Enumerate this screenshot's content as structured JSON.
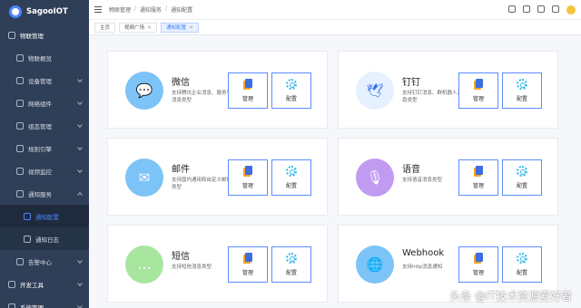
{
  "app": {
    "logo_text": "SagooIOT"
  },
  "header": {
    "breadcrumb": [
      "物联管理",
      "通知服务",
      "通知配置"
    ]
  },
  "tabs": [
    {
      "label": "主页",
      "closable": false,
      "active": false
    },
    {
      "label": "视频广场",
      "closable": true,
      "active": false
    },
    {
      "label": "通知配置",
      "closable": true,
      "active": true
    }
  ],
  "sidebar": {
    "items": [
      {
        "label": "物联管理",
        "icon": "cloud-icon",
        "level": 0,
        "expanded": true
      },
      {
        "label": "物联概览",
        "icon": "dashboard-icon",
        "level": 1
      },
      {
        "label": "设备管理",
        "icon": "device-icon",
        "level": 1,
        "caret": true
      },
      {
        "label": "网络组件",
        "icon": "network-icon",
        "level": 1,
        "caret": true
      },
      {
        "label": "组态管理",
        "icon": "layout-icon",
        "level": 1,
        "caret": true
      },
      {
        "label": "规则引擎",
        "icon": "rule-icon",
        "level": 1,
        "caret": true
      },
      {
        "label": "视频监控",
        "icon": "video-icon",
        "level": 1,
        "caret": true
      },
      {
        "label": "通知服务",
        "icon": "notify-icon",
        "level": 1,
        "caret": true,
        "expanded": true
      },
      {
        "label": "通知配置",
        "icon": "config-icon",
        "level": 2,
        "active": true
      },
      {
        "label": "通知日志",
        "icon": "log-icon",
        "level": 2
      },
      {
        "label": "告警中心",
        "icon": "alarm-icon",
        "level": 1,
        "caret": true
      },
      {
        "label": "开发工具",
        "icon": "tool-icon",
        "level": 0,
        "caret": true
      },
      {
        "label": "系统管理",
        "icon": "system-icon",
        "level": 0,
        "caret": true
      }
    ]
  },
  "channels": [
    {
      "name": "微信",
      "desc": "支持腾讯企业消息、服务号消息类型",
      "icon": "wechat-icon",
      "color": "#7cc3f7",
      "glyph": "💬"
    },
    {
      "name": "钉钉",
      "desc": "支持钉钉消息、群机器人消息类型",
      "icon": "dingtalk-icon",
      "color": "#e6f1ff",
      "glyph": "🕊"
    },
    {
      "name": "邮件",
      "desc": "支持国内通用和自定义邮件类型",
      "icon": "mail-icon",
      "color": "#7cc3f7",
      "glyph": "✉"
    },
    {
      "name": "语音",
      "desc": "支持语音消息类型",
      "icon": "microphone-icon",
      "color": "#c19af2",
      "glyph": "🎙"
    },
    {
      "name": "短信",
      "desc": "支持短信消息类型",
      "icon": "sms-icon",
      "color": "#a8e6a0",
      "glyph": "…"
    },
    {
      "name": "Webhook",
      "desc": "支持http消息通知",
      "icon": "globe-icon",
      "color": "#7cc3f7",
      "glyph": "🌐"
    }
  ],
  "buttons": {
    "manage_label": "管理",
    "config_label": "配置"
  },
  "watermark": "头条 @IT技术资源爱好者"
}
